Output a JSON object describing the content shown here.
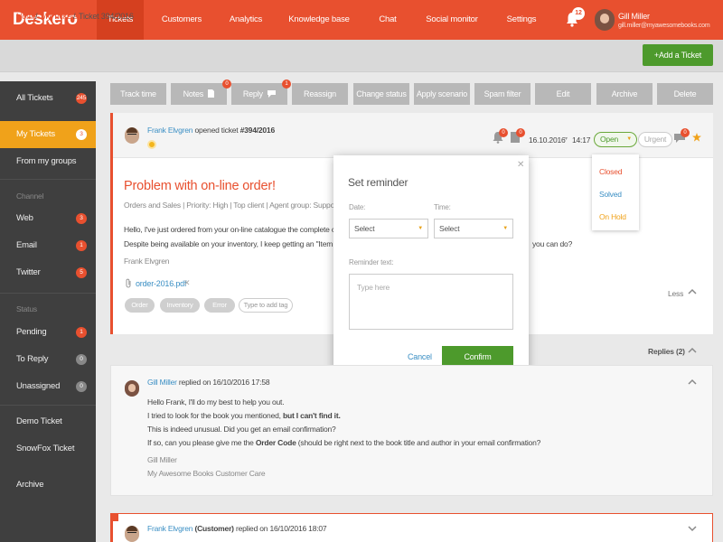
{
  "app": {
    "logo": "Deskero",
    "nav": [
      "Tickets",
      "Customers",
      "Analytics",
      "Knowledge base",
      "Chat",
      "Social monitor",
      "Settings"
    ],
    "notifications": "12",
    "user_name": "Gill Miller",
    "user_email": "gill.miller@myawesomebooks.com"
  },
  "breadcrumb": {
    "home": "Home",
    "sep1": " / ",
    "my_tickets": "My Tickets",
    "sep2": " / ",
    "current": "Ticket 394/2016"
  },
  "add_ticket": "+Add a Ticket",
  "sidebar": {
    "all_tickets": {
      "label": "All Tickets",
      "count": "245"
    },
    "my_tickets": {
      "label": "My Tickets",
      "count": "3"
    },
    "from_groups": {
      "label": "From my groups"
    },
    "channel_head": "Channel",
    "web": {
      "label": "Web",
      "count": "3"
    },
    "email": {
      "label": "Email",
      "count": "1"
    },
    "twitter": {
      "label": "Twitter",
      "count": "5"
    },
    "status_head": "Status",
    "pending": {
      "label": "Pending",
      "count": "1"
    },
    "to_reply": {
      "label": "To Reply",
      "count": "0"
    },
    "unassigned": {
      "label": "Unassigned",
      "count": "0"
    },
    "demo_ticket": "Demo Ticket",
    "snowfox_ticket": "SnowFox Ticket",
    "archive": "Archive"
  },
  "toolbar": {
    "track_time": "Track time",
    "notes": "Notes",
    "notes_count": "0",
    "reply": "Reply",
    "reply_count": "1",
    "reassign": "Reassign",
    "change_status": "Change status",
    "apply_scenario": "Apply scenario",
    "spam_filter": "Spam filter",
    "edit": "Edit",
    "archive": "Archive",
    "delete": "Delete"
  },
  "ticket": {
    "author": "Frank Elvgren",
    "opened_text": " opened ticket ",
    "number": "#394/2016",
    "bell_count": "0",
    "notes_count": "0",
    "date": "16.10.2016",
    "time": "14:17",
    "status": "Open",
    "urgent": "Urgent",
    "reply_count": "0",
    "title": "Problem with on-line order!",
    "meta": "Orders and Sales | Priority: High | Top client | Agent group: Support T",
    "body_line1": "Hello, I've just ordered from your on-line catalogue the complete colle",
    "body_line2": "Despite being available on your inventory, I keep getting an \"Item not",
    "body_line2_end": "you can do?",
    "signature": "Frank Elvgren",
    "attachment": "order-2016.pdf",
    "tags": [
      "Order",
      "Inventory",
      "Error"
    ],
    "tag_placeholder": "Type to add tag",
    "less": "Less"
  },
  "status_menu": {
    "closed": "Closed",
    "solved": "Solved",
    "on_hold": "On Hold",
    "colors": {
      "closed": "#e8502f",
      "solved": "#3b8fc4",
      "on_hold": "#f0a21a"
    }
  },
  "reminder": {
    "title": "Set reminder",
    "date_label": "Date:",
    "time_label": "Time:",
    "date_value": "Select",
    "time_value": "Select",
    "text_label": "Reminder text:",
    "placeholder": "Type here",
    "cancel": "Cancel",
    "confirm": "Confirm"
  },
  "replies": {
    "label": "Replies (2)",
    "first": {
      "author": "Gill Miller",
      "text": " replied on 16/10/2016 17:58",
      "l1": "Hello Frank, I'll do my best to help you out.",
      "l2a": "I tried to look for the book you mentioned, ",
      "l2b": "but I can't find it.",
      "l3": "This is indeed unusual. Did you get an email confirmation?",
      "l4a": "If so, can you please give me the ",
      "l4b": "Order Code",
      "l4c": " (should be right next to the book title and author in your email confirmation?",
      "sig1": "Gill Miller",
      "sig2": "My Awesome Books Customer Care"
    },
    "second": {
      "author": "Frank Elvgren",
      "role": " (Customer)",
      "text": " replied on 16/10/2016 18:07"
    }
  },
  "colors": {
    "accent": "#e8502f",
    "green": "#4d9a2c",
    "orange": "#f0a21a",
    "link": "#3b8fc4"
  }
}
